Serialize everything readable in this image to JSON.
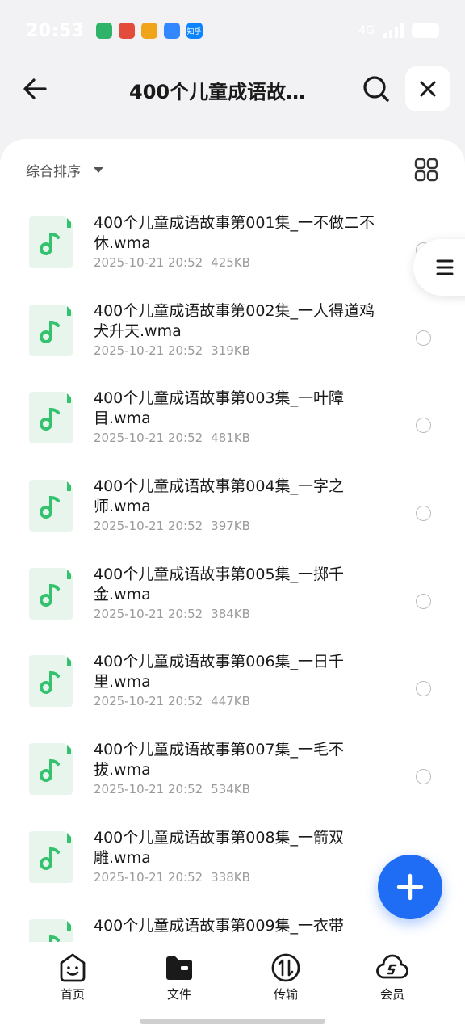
{
  "status_bar": {
    "time": "20:53",
    "apps": [
      {
        "icon": "green-app-icon",
        "color": "#2fb36b"
      },
      {
        "icon": "red-app-icon",
        "color": "#e34b3b"
      },
      {
        "icon": "yellow-app-icon",
        "color": "#f0a419"
      },
      {
        "icon": "baidu-paw-icon",
        "color": "#3388ff"
      },
      {
        "icon": "zhihu-icon",
        "color": "#0a84ff",
        "text": "知乎"
      }
    ],
    "network": "4G"
  },
  "header": {
    "title": "400个儿童成语故…",
    "back_icon": "back-arrow-icon",
    "search_icon": "search-icon",
    "close_icon": "close-icon"
  },
  "toolbar": {
    "sort_label": "综合排序",
    "grid_icon": "grid-view-icon"
  },
  "files": [
    {
      "name": "400个儿童成语故事第001集_一不做二不休.wma",
      "date": "2025-10-21 20:52",
      "size": "425KB"
    },
    {
      "name": "400个儿童成语故事第002集_一人得道鸡犬升天.wma",
      "date": "2025-10-21 20:52",
      "size": "319KB"
    },
    {
      "name": "400个儿童成语故事第003集_一叶障目.wma",
      "date": "2025-10-21 20:52",
      "size": "481KB"
    },
    {
      "name": "400个儿童成语故事第004集_一字之师.wma",
      "date": "2025-10-21 20:52",
      "size": "397KB"
    },
    {
      "name": "400个儿童成语故事第005集_一掷千金.wma",
      "date": "2025-10-21 20:52",
      "size": "384KB"
    },
    {
      "name": "400个儿童成语故事第006集_一日千里.wma",
      "date": "2025-10-21 20:52",
      "size": "447KB"
    },
    {
      "name": "400个儿童成语故事第007集_一毛不拔.wma",
      "date": "2025-10-21 20:52",
      "size": "534KB"
    },
    {
      "name": "400个儿童成语故事第008集_一箭双雕.wma",
      "date": "2025-10-21 20:52",
      "size": "338KB"
    },
    {
      "name": "400个儿童成语故事第009集_一衣带",
      "date": "",
      "size": ""
    }
  ],
  "nav": [
    {
      "label": "首页",
      "icon": "home-face-icon"
    },
    {
      "label": "文件",
      "icon": "folder-icon"
    },
    {
      "label": "传输",
      "icon": "transfer-icon"
    },
    {
      "label": "会员",
      "icon": "vip-cloud-icon"
    }
  ],
  "colors": {
    "accent": "#1f6cf5",
    "music_icon": "#34c26f",
    "music_bg": "#e7f5ec"
  }
}
